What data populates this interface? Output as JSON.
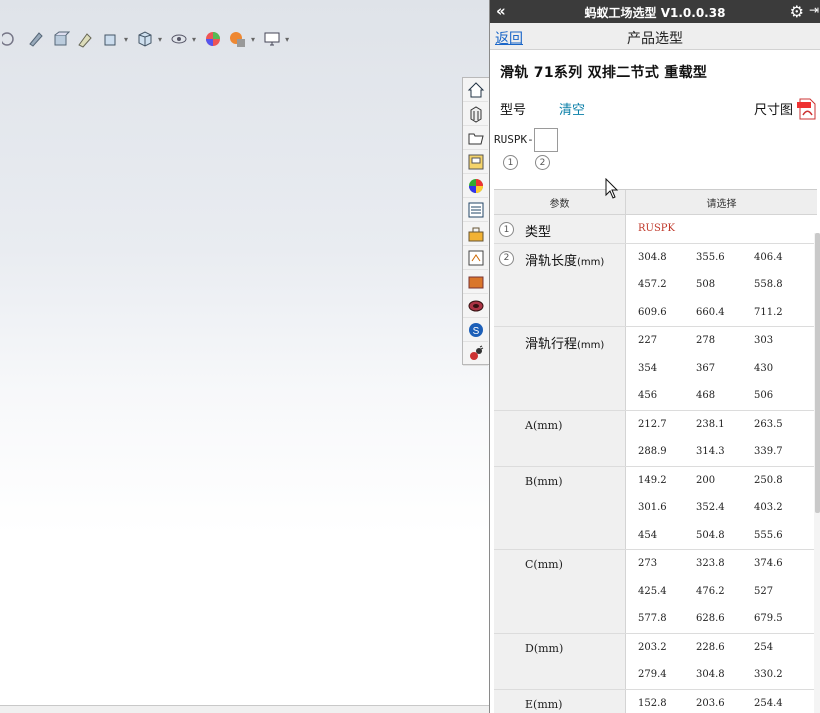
{
  "panel": {
    "title": "蚂蚁工场选型 V1.0.0.38",
    "collapse_icon": "«",
    "back_label": "返回",
    "page_title": "产品选型",
    "product_title": "滑轨  71系列  双排二节式  重载型",
    "model_label": "型号",
    "clear_label": "清空",
    "dimension_label": "尺寸图",
    "model_prefix": "RUSPK-",
    "slot_numbers": [
      "1",
      "2"
    ],
    "table_headers": [
      "参数",
      "请选择"
    ],
    "rows": [
      {
        "num": "1",
        "name": "类型",
        "unit": "",
        "values": [
          "RUSPK"
        ]
      },
      {
        "num": "2",
        "name": "滑轨长度",
        "unit": "(mm)",
        "values": [
          "304.8",
          "355.6",
          "406.4",
          "457.2",
          "508",
          "558.8",
          "609.6",
          "660.4",
          "711.2"
        ]
      },
      {
        "num": "",
        "name": "滑轨行程",
        "unit": "(mm)",
        "values": [
          "227",
          "278",
          "303",
          "354",
          "367",
          "430",
          "456",
          "468",
          "506"
        ]
      },
      {
        "num": "",
        "name": "A(mm)",
        "unit": "",
        "values": [
          "212.7",
          "238.1",
          "263.5",
          "288.9",
          "314.3",
          "339.7"
        ]
      },
      {
        "num": "",
        "name": "B(mm)",
        "unit": "",
        "values": [
          "149.2",
          "200",
          "250.8",
          "301.6",
          "352.4",
          "403.2",
          "454",
          "504.8",
          "555.6"
        ]
      },
      {
        "num": "",
        "name": "C(mm)",
        "unit": "",
        "values": [
          "273",
          "323.8",
          "374.6",
          "425.4",
          "476.2",
          "527",
          "577.8",
          "628.6",
          "679.5"
        ]
      },
      {
        "num": "",
        "name": "D(mm)",
        "unit": "",
        "values": [
          "203.2",
          "228.6",
          "254",
          "279.4",
          "304.8",
          "330.2"
        ]
      },
      {
        "num": "",
        "name": "E(mm)",
        "unit": "",
        "values": [
          "152.8",
          "203.6",
          "254.4"
        ]
      }
    ]
  },
  "colors": {
    "titlebar": "#3b3b3b",
    "link": "#1a66c8",
    "clear": "#0a7fa8",
    "type_value": "#c0392b"
  },
  "viewport_toolbar_icons": [
    "view-orientation-icon",
    "section-view-icon",
    "display-style-icon",
    "edit-appearance-icon",
    "view-settings-icon",
    "cube-icon",
    "hide-show-icon",
    "apply-scene-icon",
    "appearance-icon",
    "monitor-icon"
  ],
  "side_tabs": [
    "home-icon",
    "design-library-icon",
    "file-explorer-icon",
    "view-palette-icon",
    "appearances-icon",
    "custom-properties-icon",
    "toolbox-icon",
    "task-scheduler-icon",
    "folder-icon",
    "3d-content-icon",
    "solidworks-forum-icon",
    "ant-plugin-icon"
  ]
}
